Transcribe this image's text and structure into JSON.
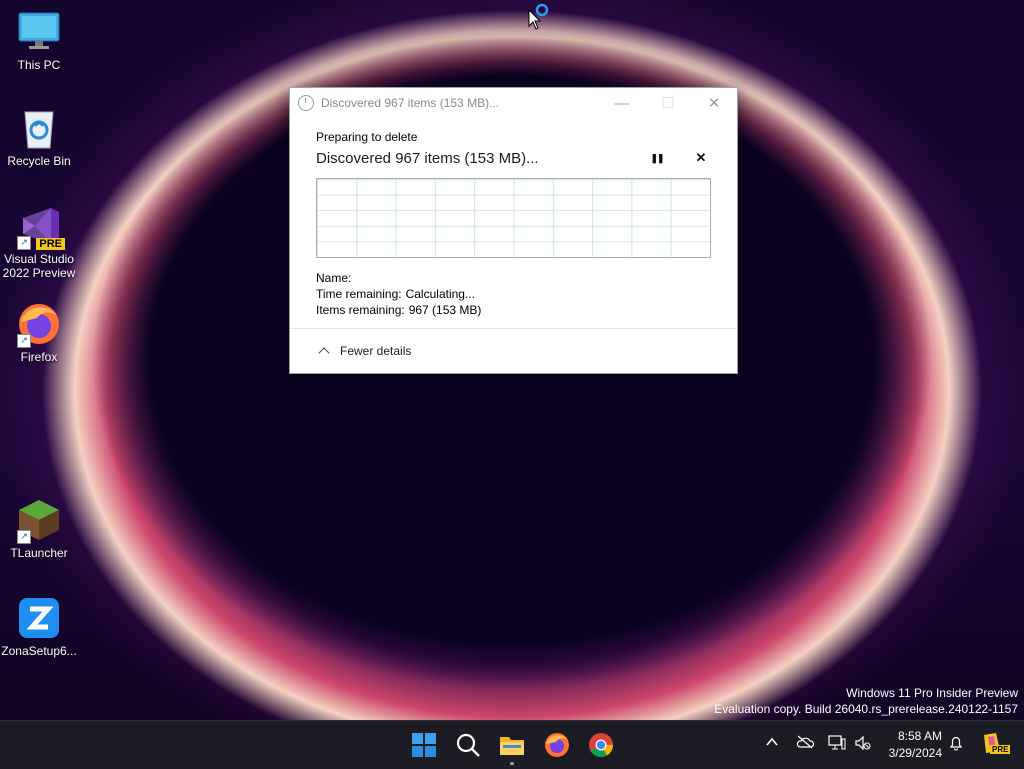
{
  "desktop": {
    "icons": [
      {
        "label": "This PC"
      },
      {
        "label": "Recycle Bin"
      },
      {
        "label": "Visual Studio 2022 Preview",
        "badge": "PRE"
      },
      {
        "label": "Firefox"
      },
      {
        "label": "TLauncher"
      },
      {
        "label": "ZonaSetup6..."
      }
    ]
  },
  "dialog": {
    "title": "Discovered 967 items (153 MB)...",
    "subtitle": "Preparing to delete",
    "headline": "Discovered 967 items (153 MB)...",
    "pause_glyph": "❚❚",
    "cancel_glyph": "✕",
    "details": {
      "name_label": "Name:",
      "name_value": "",
      "time_label": "Time remaining:",
      "time_value": "Calculating...",
      "items_label": "Items remaining:",
      "items_value": "967 (153 MB)"
    },
    "fewer_details": "Fewer details",
    "window_controls": {
      "minimize": "—",
      "maximize": "☐",
      "close": "✕"
    }
  },
  "watermark": {
    "line1": "Windows 11 Pro Insider Preview",
    "line2": "Evaluation copy. Build 26040.rs_prerelease.240122-1157"
  },
  "taskbar": {
    "apps": [
      "start-icon",
      "search-icon",
      "file-explorer-icon",
      "firefox-icon",
      "chrome-icon"
    ],
    "time": "8:58 AM",
    "date": "3/29/2024",
    "tray_badge": "PRE"
  },
  "colors": {
    "taskbar_bg": "#1c1c24",
    "accent": "#0078d4",
    "graph_grid": "#cfe8d6"
  }
}
